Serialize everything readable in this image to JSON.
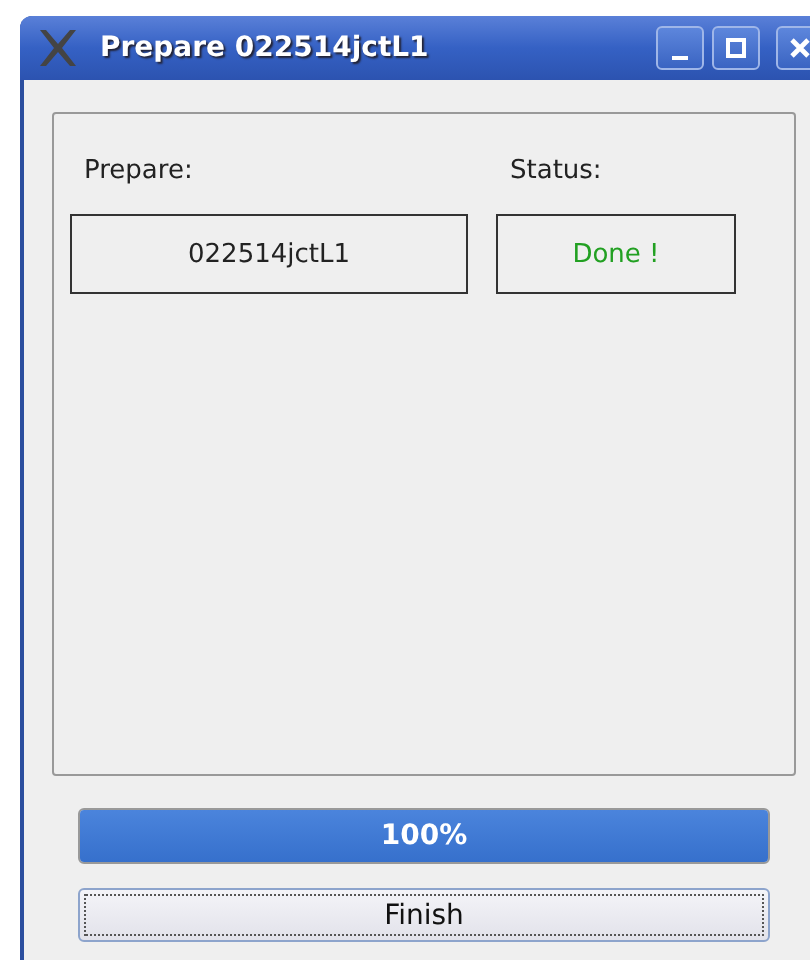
{
  "window": {
    "title": "Prepare 022514jctL1"
  },
  "labels": {
    "prepare": "Prepare:",
    "status": "Status:"
  },
  "prepare_value": "022514jctL1",
  "status": {
    "text": "Done !",
    "kind": "done"
  },
  "progress": {
    "level": 1,
    "reading": "100%"
  },
  "buttons": [
    "Finish"
  ]
}
